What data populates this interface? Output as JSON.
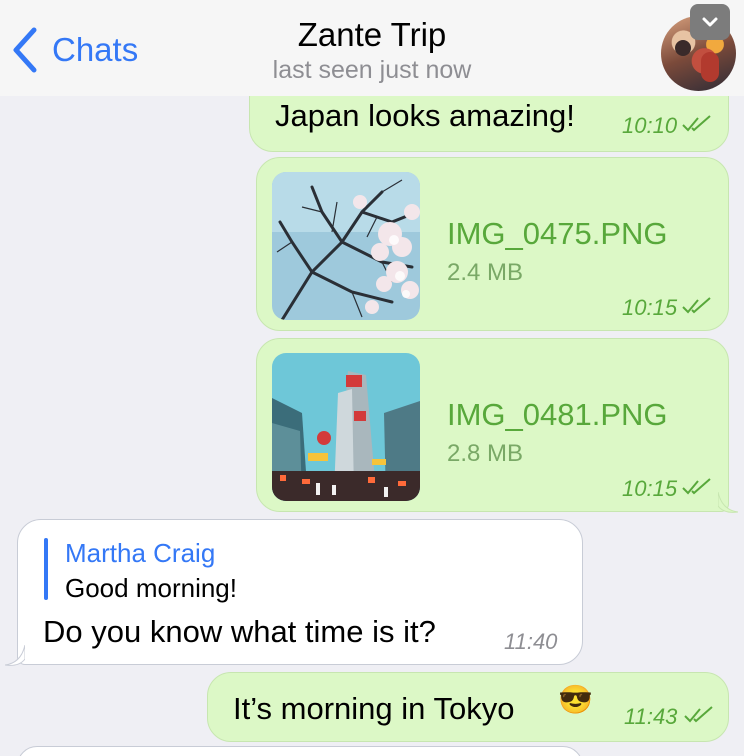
{
  "header": {
    "back_label": "Chats",
    "title": "Zante Trip",
    "subtitle": "last seen just now"
  },
  "messages": [
    {
      "type": "outgoing-text",
      "text": "Japan looks amazing!",
      "time": "10:10"
    },
    {
      "type": "outgoing-file",
      "file_name": "IMG_0475.PNG",
      "file_size": "2.4 MB",
      "time": "10:15"
    },
    {
      "type": "outgoing-file",
      "file_name": "IMG_0481.PNG",
      "file_size": "2.8 MB",
      "time": "10:15"
    },
    {
      "type": "incoming-reply",
      "reply_author": "Martha Craig",
      "reply_text": "Good morning!",
      "text": "Do you know what time is it?",
      "time": "11:40"
    },
    {
      "type": "outgoing-text",
      "text": "It’s morning in Tokyo",
      "emoji": "😎",
      "time": "11:43"
    }
  ],
  "colors": {
    "accent": "#3478f6",
    "outgoing_bubble": "#dcf8c6",
    "outgoing_meta": "#58a83b",
    "incoming_bubble": "#ffffff"
  },
  "icons": {
    "back": "chevron-left-icon",
    "menu": "chevron-down-icon",
    "read_receipt": "double-check-icon"
  }
}
